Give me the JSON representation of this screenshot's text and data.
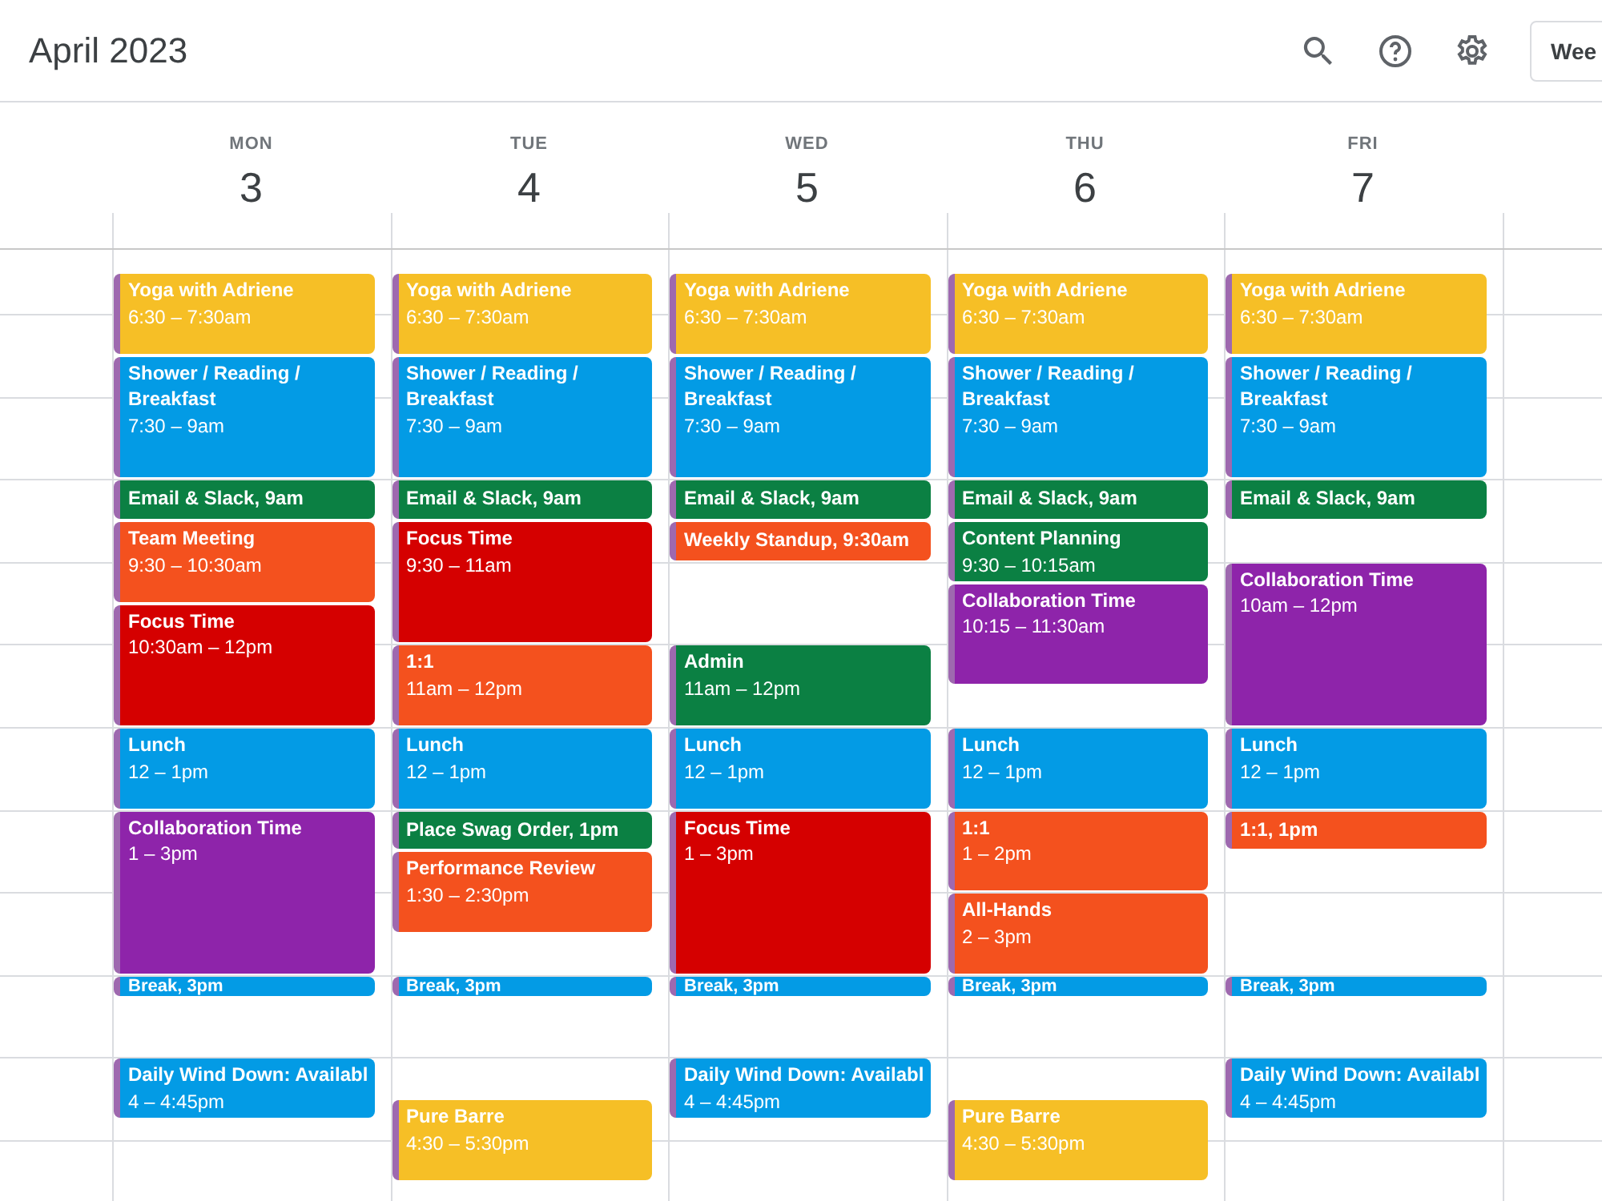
{
  "header": {
    "title": "April 2023",
    "view_button": "Wee"
  },
  "days": [
    {
      "weekday": "MON",
      "date": "3",
      "events": [
        {
          "kind": "timed",
          "title": "Yoga with Adriene",
          "time": "6:30 – 7:30am",
          "color": "#f6bf26"
        },
        {
          "kind": "timed",
          "title": "Shower / Reading / Breakfast",
          "time": "7:30 – 9am",
          "color": "#039be5"
        },
        {
          "kind": "short",
          "title": "Email & Slack, 9am",
          "color": "#0b8043"
        },
        {
          "kind": "timed",
          "title": "Team Meeting",
          "time": "9:30 – 10:30am",
          "color": "#f4511e"
        },
        {
          "kind": "timed",
          "title": "Focus Time",
          "time": "10:30am – 12pm",
          "color": "#d50000"
        },
        {
          "kind": "timed",
          "title": "Lunch",
          "time": "12 – 1pm",
          "color": "#039be5"
        },
        {
          "kind": "timed",
          "title": "Collaboration Time",
          "time": "1 – 3pm",
          "color": "#8e24aa"
        },
        {
          "kind": "mini",
          "title": "Break, 3pm",
          "color": "#039be5"
        },
        {
          "kind": "timed",
          "title": "Daily Wind Down: Availabl",
          "time": "4 – 4:45pm",
          "color": "#039be5"
        }
      ]
    },
    {
      "weekday": "TUE",
      "date": "4",
      "events": [
        {
          "kind": "timed",
          "title": "Yoga with Adriene",
          "time": "6:30 – 7:30am",
          "color": "#f6bf26"
        },
        {
          "kind": "timed",
          "title": "Shower / Reading / Breakfast",
          "time": "7:30 – 9am",
          "color": "#039be5"
        },
        {
          "kind": "short",
          "title": "Email & Slack, 9am",
          "color": "#0b8043"
        },
        {
          "kind": "timed",
          "title": "Focus Time",
          "time": "9:30 – 11am",
          "color": "#d50000"
        },
        {
          "kind": "timed",
          "title": "1:1",
          "time": "11am – 12pm",
          "color": "#f4511e"
        },
        {
          "kind": "timed",
          "title": "Lunch",
          "time": "12 – 1pm",
          "color": "#039be5"
        },
        {
          "kind": "short",
          "title": "Place Swag Order, 1pm",
          "color": "#0b8043"
        },
        {
          "kind": "timed",
          "title": "Performance Review",
          "time": "1:30 – 2:30pm",
          "color": "#f4511e"
        },
        {
          "kind": "mini",
          "title": "Break, 3pm",
          "color": "#039be5"
        },
        {
          "kind": "timed",
          "title": "Pure Barre",
          "time": "4:30 – 5:30pm",
          "color": "#f6bf26"
        }
      ]
    },
    {
      "weekday": "WED",
      "date": "5",
      "events": [
        {
          "kind": "timed",
          "title": "Yoga with Adriene",
          "time": "6:30 – 7:30am",
          "color": "#f6bf26"
        },
        {
          "kind": "timed",
          "title": "Shower / Reading / Breakfast",
          "time": "7:30 – 9am",
          "color": "#039be5"
        },
        {
          "kind": "short",
          "title": "Email & Slack, 9am",
          "color": "#0b8043"
        },
        {
          "kind": "short",
          "title": "Weekly Standup, 9:30am",
          "color": "#f4511e"
        },
        {
          "kind": "timed",
          "title": "Admin",
          "time": "11am – 12pm",
          "color": "#0b8043"
        },
        {
          "kind": "timed",
          "title": "Lunch",
          "time": "12 – 1pm",
          "color": "#039be5"
        },
        {
          "kind": "timed",
          "title": "Focus Time",
          "time": "1 – 3pm",
          "color": "#d50000"
        },
        {
          "kind": "mini",
          "title": "Break, 3pm",
          "color": "#039be5"
        },
        {
          "kind": "timed",
          "title": "Daily Wind Down: Availabl",
          "time": "4 – 4:45pm",
          "color": "#039be5"
        }
      ]
    },
    {
      "weekday": "THU",
      "date": "6",
      "events": [
        {
          "kind": "timed",
          "title": "Yoga with Adriene",
          "time": "6:30 – 7:30am",
          "color": "#f6bf26"
        },
        {
          "kind": "timed",
          "title": "Shower / Reading / Breakfast",
          "time": "7:30 – 9am",
          "color": "#039be5"
        },
        {
          "kind": "short",
          "title": "Email & Slack, 9am",
          "color": "#0b8043"
        },
        {
          "kind": "timed",
          "title": "Content Planning",
          "time": "9:30 – 10:15am",
          "color": "#0b8043"
        },
        {
          "kind": "timed",
          "title": "Collaboration Time",
          "time": "10:15 – 11:30am",
          "color": "#8e24aa"
        },
        {
          "kind": "timed",
          "title": "Lunch",
          "time": "12 – 1pm",
          "color": "#039be5"
        },
        {
          "kind": "timed",
          "title": "1:1",
          "time": "1 – 2pm",
          "color": "#f4511e"
        },
        {
          "kind": "timed",
          "title": "All-Hands",
          "time": "2 – 3pm",
          "color": "#f4511e"
        },
        {
          "kind": "mini",
          "title": "Break, 3pm",
          "color": "#039be5"
        },
        {
          "kind": "timed",
          "title": "Pure Barre",
          "time": "4:30 – 5:30pm",
          "color": "#f6bf26"
        }
      ]
    },
    {
      "weekday": "FRI",
      "date": "7",
      "events": [
        {
          "kind": "timed",
          "title": "Yoga with Adriene",
          "time": "6:30 – 7:30am",
          "color": "#f6bf26"
        },
        {
          "kind": "timed",
          "title": "Shower / Reading / Breakfast",
          "time": "7:30 – 9am",
          "color": "#039be5"
        },
        {
          "kind": "short",
          "title": "Email & Slack, 9am",
          "color": "#0b8043"
        },
        {
          "kind": "timed",
          "title": "Collaboration Time",
          "time": "10am – 12pm",
          "color": "#8e24aa"
        },
        {
          "kind": "timed",
          "title": "Lunch",
          "time": "12 – 1pm",
          "color": "#039be5"
        },
        {
          "kind": "short",
          "title": "1:1, 1pm",
          "color": "#f4511e"
        },
        {
          "kind": "mini",
          "title": "Break, 3pm",
          "color": "#039be5"
        },
        {
          "kind": "timed",
          "title": "Daily Wind Down: Availabl",
          "time": "4 – 4:45pm",
          "color": "#039be5"
        }
      ]
    }
  ]
}
